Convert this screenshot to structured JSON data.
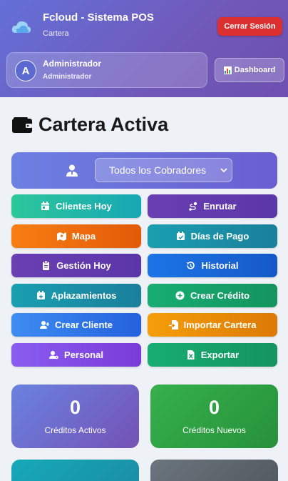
{
  "header": {
    "app_title": "Fcloud - Sistema POS",
    "app_subtitle": "Cartera",
    "logout_label": "Cerrar Sesión",
    "dashboard_label": "Dashboard"
  },
  "user": {
    "avatar_letter": "A",
    "name": "Administrador",
    "role": "Administrador"
  },
  "page": {
    "title": "Cartera Activa"
  },
  "filter": {
    "selected": "Todos los Cobradores"
  },
  "actions": [
    {
      "label": "Clientes Hoy",
      "icon": "calendar-day-icon",
      "color": "#22b9a5"
    },
    {
      "label": "Enrutar",
      "icon": "route-icon",
      "color": "#6a3fb3"
    },
    {
      "label": "Mapa",
      "icon": "map-icon",
      "color": "#f47114"
    },
    {
      "label": "Días de Pago",
      "icon": "calendar-check-icon",
      "color": "#1a8fa8"
    },
    {
      "label": "Gestión Hoy",
      "icon": "clipboard-icon",
      "color": "#6a3fb3"
    },
    {
      "label": "Historial",
      "icon": "history-icon",
      "color": "#1c6ee0"
    },
    {
      "label": "Aplazamientos",
      "icon": "calendar-plus-icon",
      "color": "#1a8fa8"
    },
    {
      "label": "Crear Crédito",
      "icon": "plus-circle-icon",
      "color": "#17a56b"
    },
    {
      "label": "Crear Cliente",
      "icon": "user-plus-icon",
      "color": "#2f7aee"
    },
    {
      "label": "Importar Cartera",
      "icon": "file-import-icon",
      "color": "#ee8e0a"
    },
    {
      "label": "Personal",
      "icon": "user-cog-icon",
      "color": "#8050e8"
    },
    {
      "label": "Exportar",
      "icon": "file-excel-icon",
      "color": "#17a56b"
    }
  ],
  "stats": [
    {
      "value": "0",
      "label": "Créditos Activos",
      "color": "#6f6ccb"
    },
    {
      "value": "0",
      "label": "Créditos Nuevos",
      "color": "#2fa445"
    }
  ]
}
